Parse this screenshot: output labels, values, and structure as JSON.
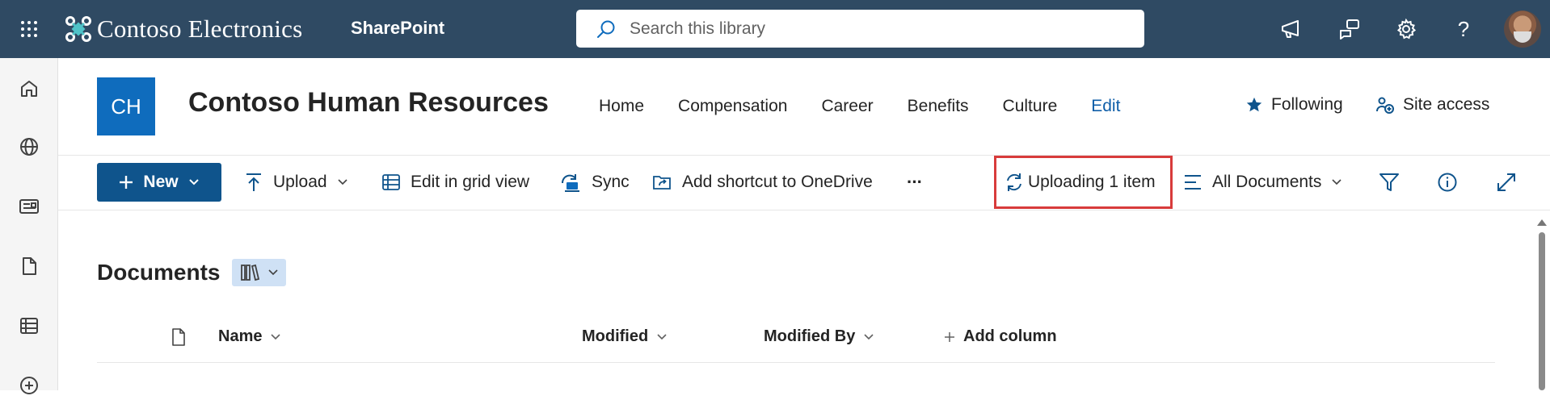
{
  "suitebar": {
    "brand": "Contoso Electronics",
    "app": "SharePoint",
    "search_placeholder": "Search this library",
    "icons": [
      "waffle-icon",
      "megaphone-icon",
      "feedback-icon",
      "gear-icon",
      "help-icon"
    ],
    "help_label": "?"
  },
  "leftrail": {
    "items": [
      "home-icon",
      "globe-icon",
      "news-icon",
      "file-icon",
      "list-icon",
      "add-icon"
    ]
  },
  "site": {
    "logo_initials": "CH",
    "title": "Contoso Human Resources",
    "nav": [
      "Home",
      "Compensation",
      "Career",
      "Benefits",
      "Culture"
    ],
    "edit_label": "Edit",
    "following_label": "Following",
    "site_access_label": "Site access"
  },
  "commandbar": {
    "new_label": "New",
    "upload_label": "Upload",
    "grid_label": "Edit in grid view",
    "sync_label": "Sync",
    "shortcut_label": "Add shortcut to OneDrive",
    "more_label": "···",
    "uploading_label": "Uploading 1 item",
    "view_label": "All Documents",
    "highlight_color": "#d83b3b"
  },
  "library": {
    "title": "Documents",
    "columns": {
      "name": "Name",
      "modified": "Modified",
      "modified_by": "Modified By",
      "add_column": "Add column"
    }
  },
  "colors": {
    "suitebar": "#2f4a63",
    "primary": "#0f548c",
    "site_logo": "#0f6cbd",
    "edit_link": "#0f5ea8"
  }
}
